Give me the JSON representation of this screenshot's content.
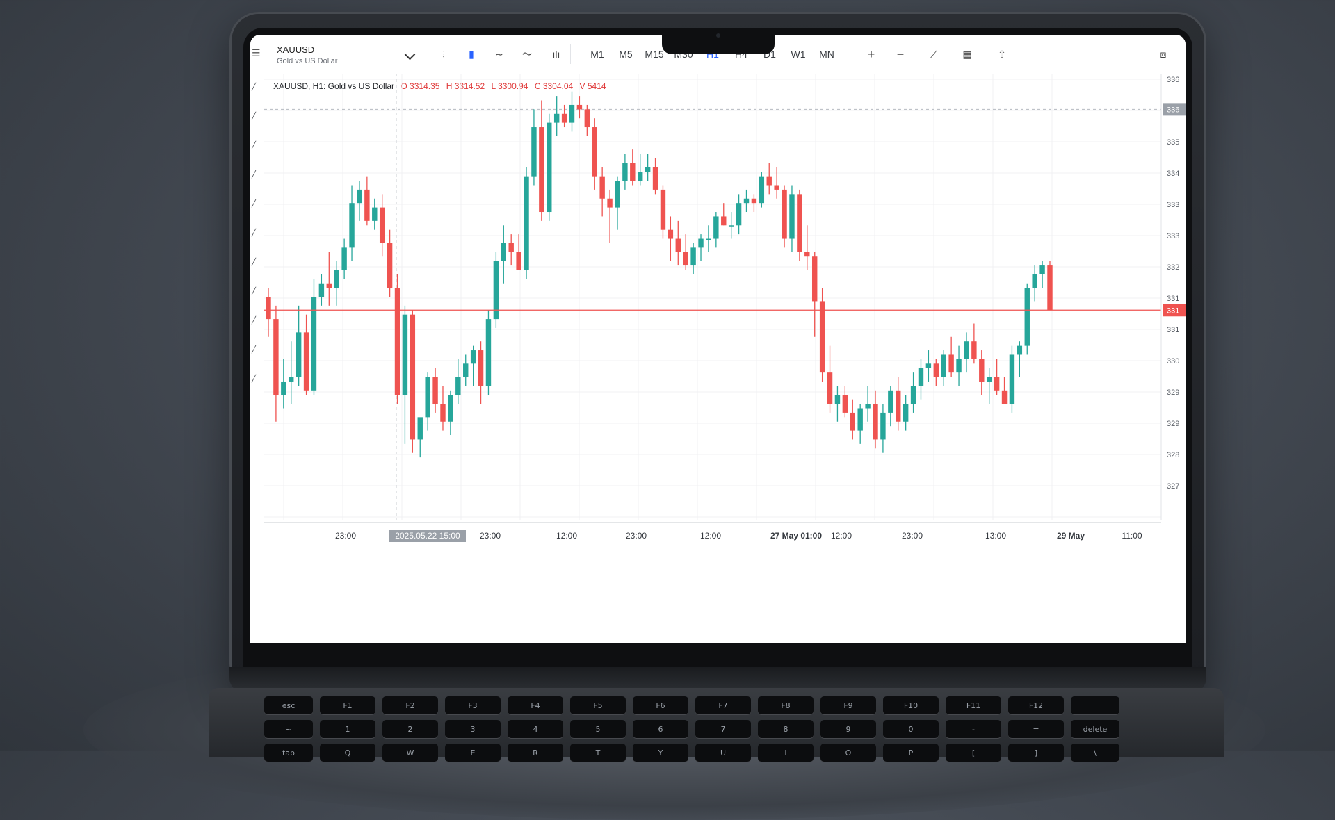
{
  "symbol": {
    "name": "XAUUSD",
    "description": "Gold vs US Dollar"
  },
  "legend": {
    "title": "XAUUSD, H1: Gold vs US Dollar",
    "open": "O 3314.35",
    "high": "H 3314.52",
    "low": "L 3300.94",
    "close": "C 3304.04",
    "volume": "V 5414"
  },
  "toolbar": {
    "chart_type_icons": [
      "bars-icon",
      "candles-icon",
      "line-icon",
      "area-line-icon",
      "indicators-icon"
    ],
    "timeframes": [
      "M1",
      "M5",
      "M15",
      "M30",
      "H1",
      "H4",
      "D1",
      "W1",
      "MN"
    ],
    "active_timeframe": "H1",
    "tools": [
      "zoom-in-icon",
      "zoom-out-icon",
      "trade-icon",
      "calendar-icon",
      "share-icon",
      "screenshot-icon"
    ]
  },
  "price_scale": {
    "labels": [
      "336",
      "336",
      "335",
      "334",
      "333",
      "333",
      "332",
      "331",
      "331",
      "330",
      "329",
      "329",
      "328",
      "327"
    ],
    "current_price_label": "331",
    "crosshair_price_label": "336"
  },
  "time_axis": {
    "labels": [
      "23:00",
      "2025.05.22 15:00",
      "23:00",
      "12:00",
      "23:00",
      "12:00",
      "27 May 01:00",
      "12:00",
      "23:00",
      "13:00",
      "29 May",
      "11:00"
    ]
  },
  "colors": {
    "up": "#26a69a",
    "down": "#ef5350",
    "accent": "#2962ff",
    "current_price_line": "#ef5350"
  },
  "chart_data": {
    "type": "candlestick",
    "symbol": "XAUUSD",
    "timeframe": "H1",
    "ylim": [
      3270,
      3370
    ],
    "candles": [
      {
        "o": 3320,
        "h": 3322,
        "l": 3311,
        "c": 3315
      },
      {
        "o": 3315,
        "h": 3318,
        "l": 3292,
        "c": 3298
      },
      {
        "o": 3298,
        "h": 3306,
        "l": 3295,
        "c": 3301
      },
      {
        "o": 3301,
        "h": 3310,
        "l": 3296,
        "c": 3302
      },
      {
        "o": 3302,
        "h": 3318,
        "l": 3300,
        "c": 3312
      },
      {
        "o": 3312,
        "h": 3316,
        "l": 3298,
        "c": 3299
      },
      {
        "o": 3299,
        "h": 3324,
        "l": 3298,
        "c": 3320
      },
      {
        "o": 3320,
        "h": 3325,
        "l": 3318,
        "c": 3323
      },
      {
        "o": 3323,
        "h": 3330,
        "l": 3318,
        "c": 3322
      },
      {
        "o": 3322,
        "h": 3328,
        "l": 3318,
        "c": 3326
      },
      {
        "o": 3326,
        "h": 3333,
        "l": 3324,
        "c": 3331
      },
      {
        "o": 3331,
        "h": 3345,
        "l": 3328,
        "c": 3341
      },
      {
        "o": 3341,
        "h": 3346,
        "l": 3337,
        "c": 3344
      },
      {
        "o": 3344,
        "h": 3347,
        "l": 3336,
        "c": 3337
      },
      {
        "o": 3337,
        "h": 3342,
        "l": 3335,
        "c": 3340
      },
      {
        "o": 3340,
        "h": 3343,
        "l": 3329,
        "c": 3332
      },
      {
        "o": 3332,
        "h": 3335,
        "l": 3320,
        "c": 3322
      },
      {
        "o": 3322,
        "h": 3325,
        "l": 3296,
        "c": 3298
      },
      {
        "o": 3298,
        "h": 3318,
        "l": 3287,
        "c": 3316
      },
      {
        "o": 3316,
        "h": 3317,
        "l": 3285,
        "c": 3288
      },
      {
        "o": 3288,
        "h": 3292,
        "l": 3284,
        "c": 3293
      },
      {
        "o": 3293,
        "h": 3303,
        "l": 3290,
        "c": 3302
      },
      {
        "o": 3302,
        "h": 3304,
        "l": 3294,
        "c": 3296
      },
      {
        "o": 3296,
        "h": 3300,
        "l": 3290,
        "c": 3292
      },
      {
        "o": 3292,
        "h": 3299,
        "l": 3289,
        "c": 3298
      },
      {
        "o": 3298,
        "h": 3306,
        "l": 3296,
        "c": 3302
      },
      {
        "o": 3302,
        "h": 3307,
        "l": 3300,
        "c": 3305
      },
      {
        "o": 3305,
        "h": 3309,
        "l": 3300,
        "c": 3308
      },
      {
        "o": 3308,
        "h": 3310,
        "l": 3296,
        "c": 3300
      },
      {
        "o": 3300,
        "h": 3317,
        "l": 3298,
        "c": 3315
      },
      {
        "o": 3315,
        "h": 3330,
        "l": 3313,
        "c": 3328
      },
      {
        "o": 3328,
        "h": 3336,
        "l": 3323,
        "c": 3332
      },
      {
        "o": 3332,
        "h": 3334,
        "l": 3327,
        "c": 3330
      },
      {
        "o": 3330,
        "h": 3334,
        "l": 3327,
        "c": 3326
      },
      {
        "o": 3326,
        "h": 3349,
        "l": 3324,
        "c": 3347
      },
      {
        "o": 3347,
        "h": 3362,
        "l": 3345,
        "c": 3358
      },
      {
        "o": 3358,
        "h": 3364,
        "l": 3337,
        "c": 3339
      },
      {
        "o": 3339,
        "h": 3361,
        "l": 3337,
        "c": 3359
      },
      {
        "o": 3359,
        "h": 3365,
        "l": 3356,
        "c": 3361
      },
      {
        "o": 3361,
        "h": 3363,
        "l": 3358,
        "c": 3359
      },
      {
        "o": 3359,
        "h": 3366,
        "l": 3357,
        "c": 3363
      },
      {
        "o": 3363,
        "h": 3365,
        "l": 3360,
        "c": 3362
      },
      {
        "o": 3362,
        "h": 3363,
        "l": 3356,
        "c": 3358
      },
      {
        "o": 3358,
        "h": 3360,
        "l": 3344,
        "c": 3347
      },
      {
        "o": 3347,
        "h": 3349,
        "l": 3338,
        "c": 3342
      },
      {
        "o": 3342,
        "h": 3344,
        "l": 3332,
        "c": 3340
      },
      {
        "o": 3340,
        "h": 3347,
        "l": 3335,
        "c": 3346
      },
      {
        "o": 3346,
        "h": 3352,
        "l": 3344,
        "c": 3350
      },
      {
        "o": 3350,
        "h": 3353,
        "l": 3345,
        "c": 3346
      },
      {
        "o": 3346,
        "h": 3352,
        "l": 3345,
        "c": 3348
      },
      {
        "o": 3348,
        "h": 3352,
        "l": 3346,
        "c": 3349
      },
      {
        "o": 3349,
        "h": 3351,
        "l": 3343,
        "c": 3344
      },
      {
        "o": 3344,
        "h": 3345,
        "l": 3333,
        "c": 3335
      },
      {
        "o": 3335,
        "h": 3338,
        "l": 3328,
        "c": 3333
      },
      {
        "o": 3333,
        "h": 3337,
        "l": 3327,
        "c": 3330
      },
      {
        "o": 3330,
        "h": 3334,
        "l": 3326,
        "c": 3327
      },
      {
        "o": 3327,
        "h": 3332,
        "l": 3325,
        "c": 3331
      },
      {
        "o": 3331,
        "h": 3334,
        "l": 3328,
        "c": 3333
      },
      {
        "o": 3333,
        "h": 3336,
        "l": 3330,
        "c": 3333
      },
      {
        "o": 3333,
        "h": 3339,
        "l": 3331,
        "c": 3338
      },
      {
        "o": 3338,
        "h": 3341,
        "l": 3336,
        "c": 3336
      },
      {
        "o": 3336,
        "h": 3339,
        "l": 3333,
        "c": 3336
      },
      {
        "o": 3336,
        "h": 3343,
        "l": 3334,
        "c": 3341
      },
      {
        "o": 3341,
        "h": 3344,
        "l": 3339,
        "c": 3342
      },
      {
        "o": 3342,
        "h": 3343,
        "l": 3339,
        "c": 3341
      },
      {
        "o": 3341,
        "h": 3348,
        "l": 3340,
        "c": 3347
      },
      {
        "o": 3347,
        "h": 3350,
        "l": 3343,
        "c": 3345
      },
      {
        "o": 3345,
        "h": 3349,
        "l": 3342,
        "c": 3344
      },
      {
        "o": 3344,
        "h": 3345,
        "l": 3331,
        "c": 3333
      },
      {
        "o": 3333,
        "h": 3345,
        "l": 3330,
        "c": 3343
      },
      {
        "o": 3343,
        "h": 3344,
        "l": 3328,
        "c": 3330
      },
      {
        "o": 3330,
        "h": 3336,
        "l": 3326,
        "c": 3329
      },
      {
        "o": 3329,
        "h": 3330,
        "l": 3311,
        "c": 3319
      },
      {
        "o": 3319,
        "h": 3322,
        "l": 3301,
        "c": 3303
      },
      {
        "o": 3303,
        "h": 3309,
        "l": 3294,
        "c": 3296
      },
      {
        "o": 3296,
        "h": 3300,
        "l": 3292,
        "c": 3298
      },
      {
        "o": 3298,
        "h": 3300,
        "l": 3293,
        "c": 3294
      },
      {
        "o": 3294,
        "h": 3297,
        "l": 3288,
        "c": 3290
      },
      {
        "o": 3290,
        "h": 3296,
        "l": 3287,
        "c": 3295
      },
      {
        "o": 3295,
        "h": 3300,
        "l": 3292,
        "c": 3296
      },
      {
        "o": 3296,
        "h": 3299,
        "l": 3286,
        "c": 3288
      },
      {
        "o": 3288,
        "h": 3296,
        "l": 3285,
        "c": 3294
      },
      {
        "o": 3294,
        "h": 3300,
        "l": 3291,
        "c": 3299
      },
      {
        "o": 3299,
        "h": 3302,
        "l": 3290,
        "c": 3292
      },
      {
        "o": 3292,
        "h": 3298,
        "l": 3290,
        "c": 3296
      },
      {
        "o": 3296,
        "h": 3303,
        "l": 3294,
        "c": 3300
      },
      {
        "o": 3300,
        "h": 3306,
        "l": 3297,
        "c": 3304
      },
      {
        "o": 3304,
        "h": 3308,
        "l": 3301,
        "c": 3305
      },
      {
        "o": 3305,
        "h": 3306,
        "l": 3300,
        "c": 3302
      },
      {
        "o": 3302,
        "h": 3308,
        "l": 3300,
        "c": 3307
      },
      {
        "o": 3307,
        "h": 3311,
        "l": 3302,
        "c": 3303
      },
      {
        "o": 3303,
        "h": 3309,
        "l": 3300,
        "c": 3306
      },
      {
        "o": 3306,
        "h": 3312,
        "l": 3303,
        "c": 3310
      },
      {
        "o": 3310,
        "h": 3314,
        "l": 3305,
        "c": 3306
      },
      {
        "o": 3306,
        "h": 3308,
        "l": 3298,
        "c": 3301
      },
      {
        "o": 3301,
        "h": 3304,
        "l": 3296,
        "c": 3302
      },
      {
        "o": 3302,
        "h": 3306,
        "l": 3298,
        "c": 3299
      },
      {
        "o": 3299,
        "h": 3302,
        "l": 3297,
        "c": 3296
      },
      {
        "o": 3296,
        "h": 3309,
        "l": 3294,
        "c": 3307
      },
      {
        "o": 3307,
        "h": 3310,
        "l": 3302,
        "c": 3309
      },
      {
        "o": 3309,
        "h": 3323,
        "l": 3307,
        "c": 3322
      },
      {
        "o": 3322,
        "h": 3327,
        "l": 3319,
        "c": 3325
      },
      {
        "o": 3325,
        "h": 3328,
        "l": 3322,
        "c": 3327
      },
      {
        "o": 3327,
        "h": 3328,
        "l": 3322,
        "c": 3317
      }
    ]
  }
}
